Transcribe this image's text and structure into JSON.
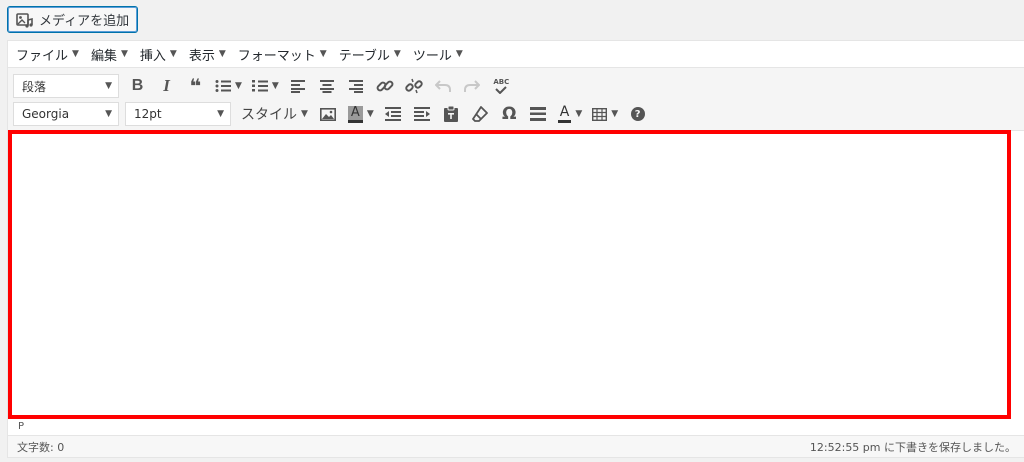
{
  "media_button": {
    "label": "メディアを追加",
    "icon": "media-add-icon"
  },
  "menubar": {
    "items": [
      {
        "label": "ファイル"
      },
      {
        "label": "編集"
      },
      {
        "label": "挿入"
      },
      {
        "label": "表示"
      },
      {
        "label": "フォーマット"
      },
      {
        "label": "テーブル"
      },
      {
        "label": "ツール"
      }
    ]
  },
  "toolbar": {
    "format_select": "段落",
    "font_family_select": "Georgia",
    "font_size_select": "12pt",
    "styles_label": "スタイル",
    "bold_glyph": "B",
    "italic_glyph": "I",
    "quote_glyph": "❝",
    "special_char_glyph": "Ω",
    "help_glyph": "?",
    "text_color_glyph": "A",
    "bg_color_glyph": "A",
    "spell_glyph": "ABC"
  },
  "colors": {
    "accent": "#0073aa",
    "highlight_border": "#ff0000"
  },
  "pathbar": {
    "path": "P"
  },
  "status": {
    "word_count": "文字数: 0",
    "saved": "12:52:55 pm に下書きを保存しました。"
  }
}
